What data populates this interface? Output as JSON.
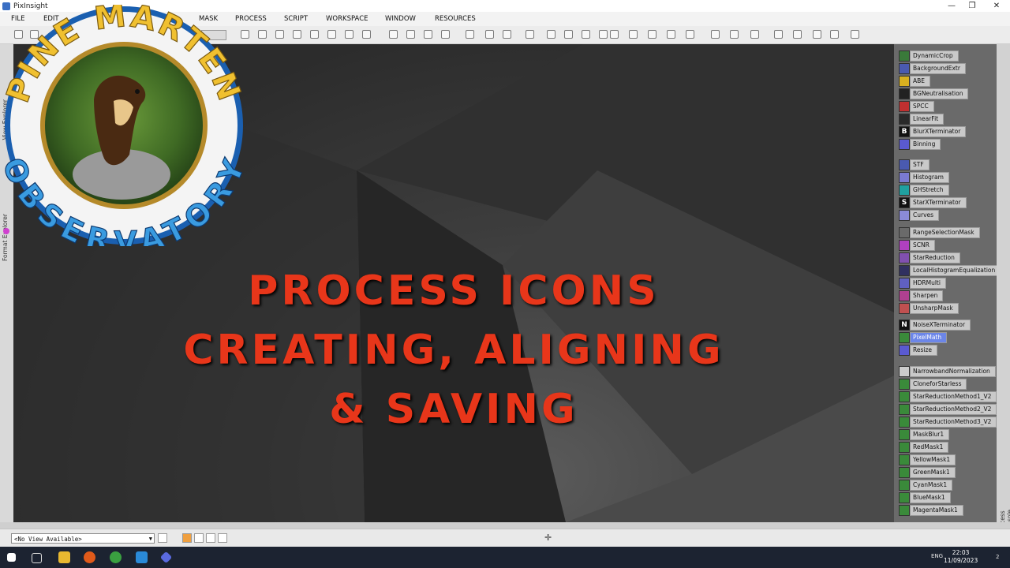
{
  "window": {
    "title": "PixInsight",
    "controls": {
      "minimize": "—",
      "maximize": "❐",
      "close": "✕"
    }
  },
  "menu": [
    "FILE",
    "EDIT",
    "MASK",
    "PROCESS",
    "SCRIPT",
    "WORKSPACE",
    "WINDOW",
    "RESOURCES"
  ],
  "left_panel": {
    "tabs": [
      "View Explorer",
      "Format Explorer"
    ]
  },
  "logo": {
    "top_text": "PINE MARTEN",
    "bottom_text": "OBSERVATORY"
  },
  "headline": [
    "PROCESS ICONS",
    "CREATING, ALIGNING",
    "& SAVING"
  ],
  "process_icons": [
    {
      "label": "DynamicCrop",
      "icon": "crop-icon",
      "color": "#3a7a3a"
    },
    {
      "label": "BackgroundExtr",
      "icon": "background-icon",
      "color": "#4a5ab0"
    },
    {
      "label": "ABE",
      "icon": "abe-icon",
      "color": "#d8b020"
    },
    {
      "label": "BGNeutralisation",
      "icon": "bgneutral-icon",
      "color": "#222222"
    },
    {
      "label": "SPCC",
      "icon": "spcc-icon",
      "color": "#c03030"
    },
    {
      "label": "LinearFit",
      "icon": "linearfit-icon",
      "color": "#2a2a2a"
    },
    {
      "label": "BlurXTerminator",
      "icon": "b-icon",
      "color": "#111111",
      "glyph": "B"
    },
    {
      "label": "Binning",
      "icon": "binning-icon",
      "color": "#5a5ad0"
    },
    {
      "label": "STF",
      "icon": "stf-icon",
      "color": "#4a5ab0"
    },
    {
      "label": "Histogram",
      "icon": "histogram-icon",
      "color": "#7a7ad0"
    },
    {
      "label": "GHStretch",
      "icon": "ghs-icon",
      "color": "#20a0a0"
    },
    {
      "label": "StarXTerminator",
      "icon": "s-icon",
      "color": "#111111",
      "glyph": "S"
    },
    {
      "label": "Curves",
      "icon": "curves-icon",
      "color": "#8a8ad8"
    },
    {
      "label": "RangeSelectionMask",
      "icon": "range-mask-icon",
      "color": "#6a6a6a"
    },
    {
      "label": "SCNR",
      "icon": "scnr-icon",
      "color": "#b040c0"
    },
    {
      "label": "StarReduction",
      "icon": "starreduction-icon",
      "color": "#8050b0"
    },
    {
      "label": "LocalHistogramEqualization",
      "icon": "lhe-icon",
      "color": "#303060"
    },
    {
      "label": "HDRMulti",
      "icon": "hdr-icon",
      "color": "#6060c0"
    },
    {
      "label": "Sharpen",
      "icon": "sharpen-icon",
      "color": "#b04090"
    },
    {
      "label": "UnsharpMask",
      "icon": "unsharp-icon",
      "color": "#c05050"
    },
    {
      "label": "NoiseXTerminator",
      "icon": "n-icon",
      "color": "#111111",
      "glyph": "N"
    },
    {
      "label": "PixelMath",
      "icon": "pixelmath-icon",
      "color": "#3a8a3a",
      "selected": true
    },
    {
      "label": "Resize",
      "icon": "resize-icon",
      "color": "#5a5ad0"
    },
    {
      "label": "NarrowbandNormalization",
      "icon": "gear-icon",
      "color": "#cccccc"
    },
    {
      "label": "CloneforStarless",
      "icon": "script-icon",
      "color": "#3a8a3a"
    },
    {
      "label": "StarReductionMethod1_V2",
      "icon": "script-icon",
      "color": "#3a8a3a"
    },
    {
      "label": "StarReductionMethod2_V2",
      "icon": "script-icon",
      "color": "#3a8a3a"
    },
    {
      "label": "StarReductionMethod3_V2",
      "icon": "script-icon",
      "color": "#3a8a3a"
    },
    {
      "label": "MaskBlur1",
      "icon": "script-icon",
      "color": "#3a8a3a"
    },
    {
      "label": "RedMask1",
      "icon": "script-icon",
      "color": "#3a8a3a"
    },
    {
      "label": "YellowMask1",
      "icon": "script-icon",
      "color": "#3a8a3a"
    },
    {
      "label": "GreenMask1",
      "icon": "script-icon",
      "color": "#3a8a3a"
    },
    {
      "label": "CyanMask1",
      "icon": "script-icon",
      "color": "#3a8a3a"
    },
    {
      "label": "BlueMask1",
      "icon": "script-icon",
      "color": "#3a8a3a"
    },
    {
      "label": "MagentaMask1",
      "icon": "script-icon",
      "color": "#3a8a3a"
    }
  ],
  "process_console": {
    "label": "Process Console"
  },
  "statusbar": {
    "view_select": "<No View Available>",
    "arrow": "▼"
  },
  "taskbar": {
    "language": "ENG",
    "time": "22:03",
    "date": "11/09/2023",
    "notifications": "2"
  },
  "colors": {
    "accent_red": "#e8361a",
    "selected_blue": "#6c86e8"
  }
}
